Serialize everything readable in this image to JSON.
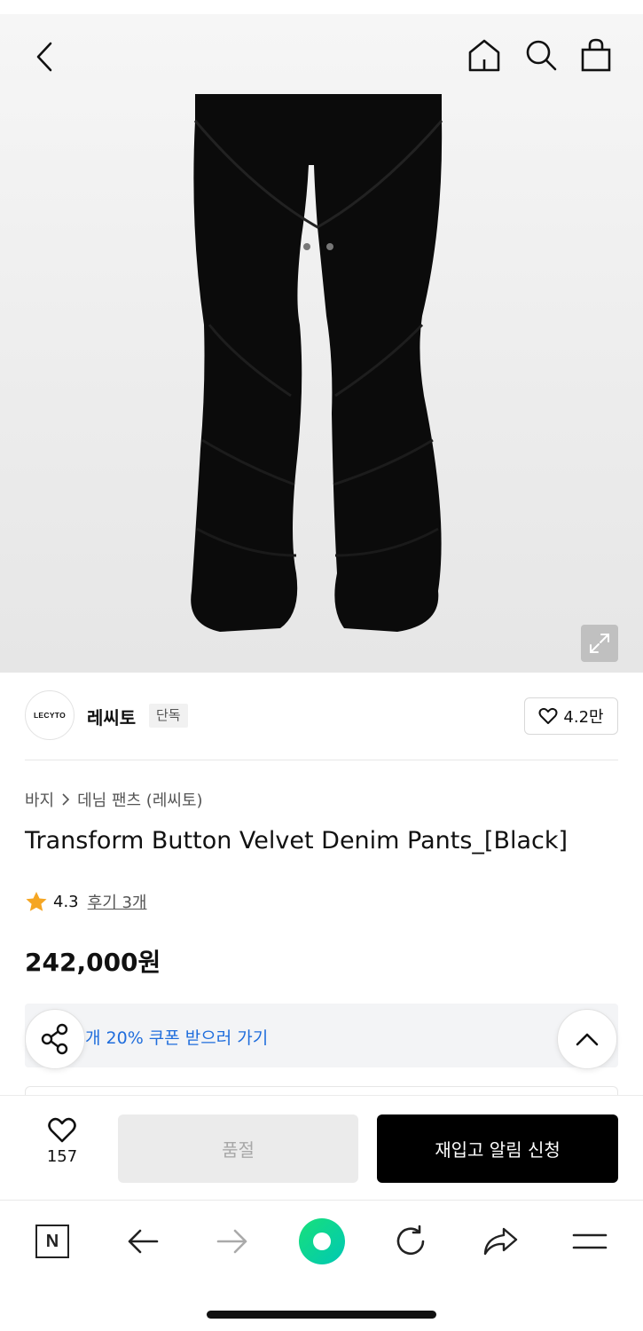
{
  "header": {
    "back_icon": "chevron-left-icon",
    "home_icon": "home-icon",
    "search_icon": "search-icon",
    "cart_icon": "shopping-bag-icon"
  },
  "product_image": {
    "alt_subject": "black velvet denim pants",
    "expand_icon": "expand-icon"
  },
  "brand": {
    "logo_text": "LECYTO",
    "name": "레씨토",
    "badge": "단독",
    "favorite_count": "4.2만"
  },
  "breadcrumb": {
    "category": "바지",
    "subcategory": "데님 팬츠 (레씨토)"
  },
  "product": {
    "title": "Transform Button Velvet Denim Pants_[Black]",
    "rating": "4.3",
    "reviews_label": "후기 3개",
    "price": "242,000원"
  },
  "coupon": {
    "text": "개 20% 쿠폰 받으러 가기"
  },
  "action_bar": {
    "like_count": "157",
    "soldout_label": "품절",
    "restock_label": "재입고 알림 신청"
  },
  "browser_nav": {
    "home_label": "N"
  },
  "colors": {
    "coupon_text": "#1f6ddc",
    "primary_button": "#000000",
    "disabled_button": "#ebebeb",
    "rating_star": "#f5a623",
    "green_accent": "#18e07a"
  }
}
